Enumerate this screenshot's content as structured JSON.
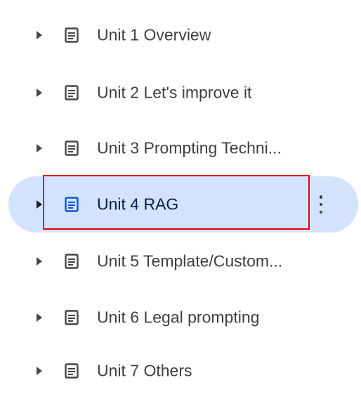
{
  "outline": {
    "items": [
      {
        "label": "Unit 1 Overview",
        "icon": "document-icon",
        "expand_icon": "caret-right-icon",
        "selected": false
      },
      {
        "label": "Unit 2 Let's improve it",
        "icon": "document-icon",
        "expand_icon": "caret-right-icon",
        "selected": false
      },
      {
        "label": "Unit 3 Prompting Techni...",
        "icon": "document-icon",
        "expand_icon": "caret-right-icon",
        "selected": false
      },
      {
        "label": "Unit 4 RAG",
        "icon": "document-icon",
        "expand_icon": "caret-right-icon",
        "selected": true,
        "more_icon": "more-vert-icon"
      },
      {
        "label": "Unit 5 Template/Custom...",
        "icon": "document-icon",
        "expand_icon": "caret-right-icon",
        "selected": false
      },
      {
        "label": "Unit 6 Legal prompting",
        "icon": "document-icon",
        "expand_icon": "caret-right-icon",
        "selected": false
      },
      {
        "label": "Unit 7 Others",
        "icon": "document-icon",
        "expand_icon": "caret-right-icon",
        "selected": false
      }
    ]
  },
  "colors": {
    "selected_background": "#d3e3fd",
    "highlight_border": "#e8000b",
    "text": "#3c4043"
  }
}
